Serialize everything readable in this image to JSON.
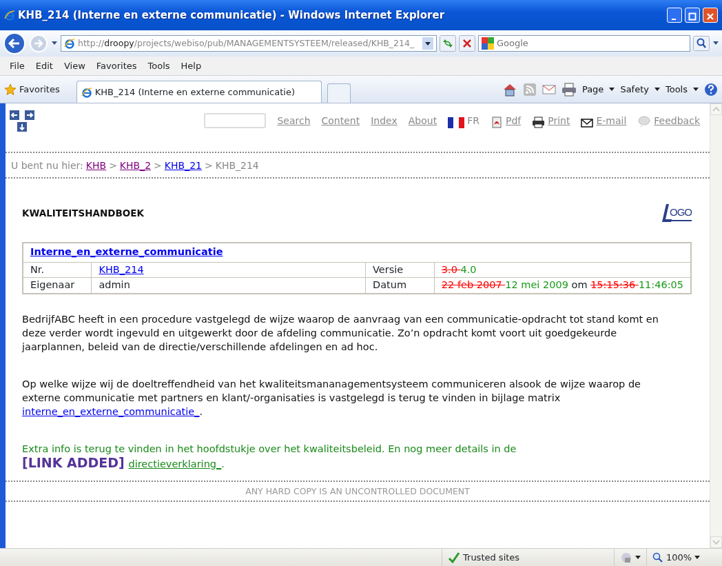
{
  "window": {
    "title": "KHB_214 (Interne en externe communicatie) - Windows Internet Explorer"
  },
  "address_bar": {
    "scheme": "http://",
    "host": "droopy",
    "path": "/projects/webiso/pub/MANAGEMENTSYSTEEM/released/KHB_214_"
  },
  "search": {
    "placeholder": "Google"
  },
  "menu": [
    "File",
    "Edit",
    "View",
    "Favorites",
    "Tools",
    "Help"
  ],
  "favorites_button": "Favorites",
  "tabs": [
    {
      "label": "KHB_214 (Interne en externe communicatie)",
      "selected": true
    }
  ],
  "command_bar": [
    "Page",
    "Safety",
    "Tools"
  ],
  "page_toolbar": [
    {
      "label": "Search",
      "kind": "link"
    },
    {
      "label": "Content",
      "kind": "link"
    },
    {
      "label": "Index",
      "kind": "link"
    },
    {
      "label": "About",
      "kind": "link"
    },
    {
      "label": "FR",
      "kind": "language"
    },
    {
      "label": "Pdf",
      "kind": "link"
    },
    {
      "label": "Print",
      "kind": "link"
    },
    {
      "label": "E-mail",
      "kind": "link"
    },
    {
      "label": "Feedback",
      "kind": "link"
    }
  ],
  "breadcrumb": {
    "label": "U bent nu hier:",
    "items": [
      {
        "kind": "link",
        "text": "KHB",
        "visited": true
      },
      {
        "kind": "separator",
        "text": ">"
      },
      {
        "kind": "link",
        "text": "KHB_2",
        "visited": true
      },
      {
        "kind": "separator",
        "text": ">"
      },
      {
        "kind": "link",
        "text": "KHB_21",
        "visited": false
      },
      {
        "kind": "separator",
        "text": ">"
      },
      {
        "kind": "current",
        "text": "KHB_214"
      }
    ]
  },
  "heading": "KWALITEITSHANDBOEK",
  "logo": {
    "text": "OGO"
  },
  "document": {
    "title": "Interne_en_externe_communicatie",
    "fields": [
      {
        "label": "Nr.",
        "value": [
          {
            "kind": "link",
            "text": "KHB_214"
          }
        ]
      },
      {
        "label": "Versie",
        "value": [
          {
            "kind": "deleted",
            "text": "3.0 "
          },
          {
            "kind": "inserted",
            "text": "4.0"
          }
        ]
      },
      {
        "label": "Eigenaar",
        "value": [
          {
            "kind": "plain",
            "text": "admin"
          }
        ]
      },
      {
        "label": "Datum",
        "value": [
          {
            "kind": "deleted",
            "text": "22 feb 2007 "
          },
          {
            "kind": "inserted",
            "text": "12 mei 2009"
          },
          {
            "kind": "plain",
            "text": " om "
          },
          {
            "kind": "deleted",
            "text": "15:15:36 "
          },
          {
            "kind": "inserted",
            "text": "11:46:05"
          }
        ]
      }
    ]
  },
  "paragraphs": [
    {
      "kind": "plain",
      "parts": [
        {
          "kind": "text",
          "text": "BedrijfABC heeft in een procedure vastgelegd de wijze waarop de aanvraag van een communicatie-opdracht tot stand komt en deze verder wordt ingevuld en uitgewerkt door de afdeling communicatie. Zo’n opdracht komt voort uit goedgekeurde jaarplannen, beleid van de directie/verschillende afdelingen en ad hoc."
        }
      ]
    },
    {
      "kind": "plain",
      "parts": [
        {
          "kind": "text",
          "text": "Op welke wijze wij de doeltreffendheid van het kwaliteitsmananagementsysteem communiceren alsook de wijze waarop de externe communicatie met partners en klant/-organisaties is vastgelegd is terug te vinden in bijlage matrix "
        },
        {
          "kind": "link",
          "text": "interne_en_externe_communicatie_"
        },
        {
          "kind": "text",
          "text": "."
        }
      ]
    },
    {
      "kind": "added",
      "parts": [
        {
          "kind": "text",
          "text": "Extra info is terug te vinden in het hoofdstukje over het kwaliteitsbeleid. En nog meer details in de "
        },
        {
          "kind": "tag",
          "text": "[LINK ADDED]"
        },
        {
          "kind": "link",
          "text": "directieverklaring_"
        },
        {
          "kind": "text",
          "text": "."
        }
      ]
    }
  ],
  "footer": "ANY HARD COPY IS AN UNCONTROLLED DOCUMENT",
  "status_bar": {
    "zone": "Trusted sites",
    "zoom": "100%"
  }
}
